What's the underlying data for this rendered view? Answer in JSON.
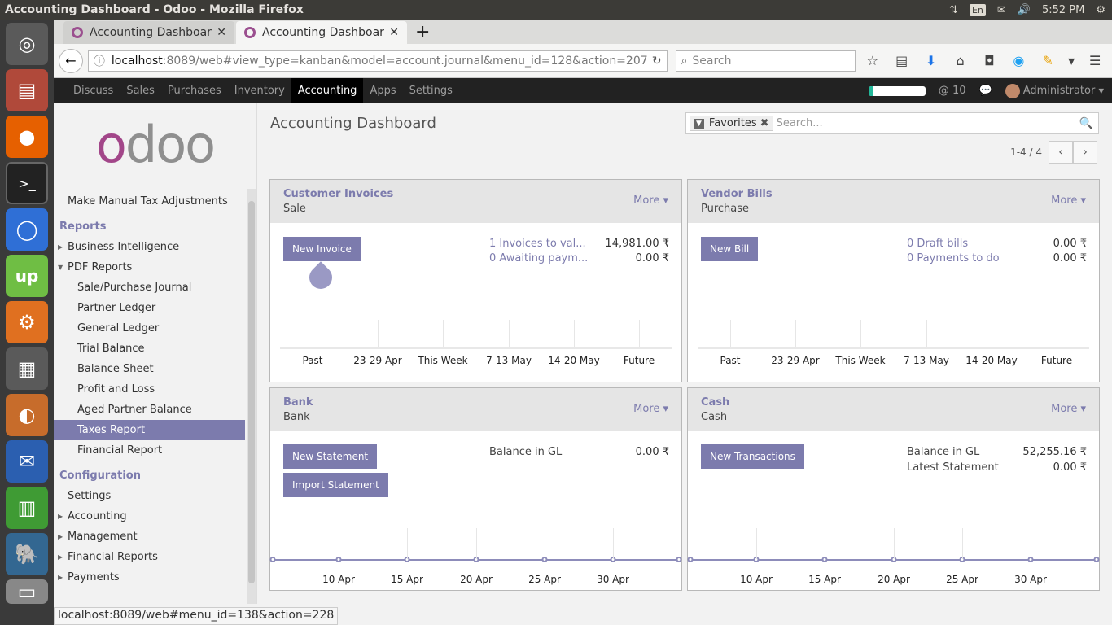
{
  "window": {
    "title": "Accounting Dashboard - Odoo - Mozilla Firefox",
    "lang": "En",
    "time": "5:52 PM"
  },
  "firefox": {
    "tabs": [
      {
        "label": "Accounting Dashboard"
      },
      {
        "label": "Accounting Dashboard"
      }
    ],
    "url": {
      "host": "localhost",
      "rest": ":8089/web#view_type=kanban&model=account.journal&menu_id=128&action=207"
    },
    "search_placeholder": "Search"
  },
  "odoo_nav": {
    "menu": [
      "Discuss",
      "Sales",
      "Purchases",
      "Inventory",
      "Accounting",
      "Apps",
      "Settings"
    ],
    "active": "Accounting",
    "progress": 0.08,
    "messages_count": "10",
    "user": "Administrator"
  },
  "sidebar": {
    "items": [
      {
        "label": "Make Manual Tax Adjustments",
        "level": "l1"
      },
      {
        "label": "Reports",
        "level": "hdr"
      },
      {
        "label": "Business Intelligence",
        "level": "l1",
        "caret": "▶"
      },
      {
        "label": "PDF Reports",
        "level": "l1",
        "caret": "▼"
      },
      {
        "label": "Sale/Purchase Journal",
        "level": "l2"
      },
      {
        "label": "Partner Ledger",
        "level": "l2"
      },
      {
        "label": "General Ledger",
        "level": "l2"
      },
      {
        "label": "Trial Balance",
        "level": "l2"
      },
      {
        "label": "Balance Sheet",
        "level": "l2"
      },
      {
        "label": "Profit and Loss",
        "level": "l2"
      },
      {
        "label": "Aged Partner Balance",
        "level": "l2"
      },
      {
        "label": "Taxes Report",
        "level": "l2",
        "selected": true
      },
      {
        "label": "Financial Report",
        "level": "l2"
      },
      {
        "label": "Configuration",
        "level": "hdr"
      },
      {
        "label": "Settings",
        "level": "l1"
      },
      {
        "label": "Accounting",
        "level": "l1",
        "caret": "▶"
      },
      {
        "label": "Management",
        "level": "l1",
        "caret": "▶"
      },
      {
        "label": "Financial Reports",
        "level": "l1",
        "caret": "▶"
      },
      {
        "label": "Payments",
        "level": "l1",
        "caret": "▶"
      }
    ]
  },
  "main": {
    "title": "Accounting Dashboard",
    "facet": "Favorites",
    "search_placeholder": "Search...",
    "pager": "1-4 / 4"
  },
  "cards": {
    "customer": {
      "title": "Customer Invoices",
      "subtitle": "Sale",
      "more": "More ▾",
      "button": "New Invoice",
      "line1": {
        "label": "1 Invoices to val...",
        "amount": "14,981.00 ₹"
      },
      "line2": {
        "label": "0 Awaiting paym...",
        "amount": "0.00 ₹"
      },
      "x": [
        "Past",
        "23-29 Apr",
        "This Week",
        "7-13 May",
        "14-20 May",
        "Future"
      ]
    },
    "vendor": {
      "title": "Vendor Bills",
      "subtitle": "Purchase",
      "more": "More ▾",
      "button": "New Bill",
      "line1": {
        "label": "0 Draft bills",
        "amount": "0.00 ₹"
      },
      "line2": {
        "label": "0 Payments to do",
        "amount": "0.00 ₹"
      },
      "x": [
        "Past",
        "23-29 Apr",
        "This Week",
        "7-13 May",
        "14-20 May",
        "Future"
      ]
    },
    "bank": {
      "title": "Bank",
      "subtitle": "Bank",
      "more": "More ▾",
      "button1": "New Statement",
      "button2": "Import Statement",
      "line1": {
        "label": "Balance in GL",
        "amount": "0.00 ₹"
      },
      "x": [
        "10 Apr",
        "15 Apr",
        "20 Apr",
        "25 Apr",
        "30 Apr"
      ]
    },
    "cash": {
      "title": "Cash",
      "subtitle": "Cash",
      "more": "More ▾",
      "button": "New Transactions",
      "line1": {
        "label": "Balance in GL",
        "amount": "52,255.16 ₹"
      },
      "line2": {
        "label": "Latest Statement",
        "amount": "0.00 ₹"
      },
      "x": [
        "10 Apr",
        "15 Apr",
        "20 Apr",
        "25 Apr",
        "30 Apr"
      ]
    }
  },
  "status_url": "localhost:8089/web#menu_id=138&action=228"
}
